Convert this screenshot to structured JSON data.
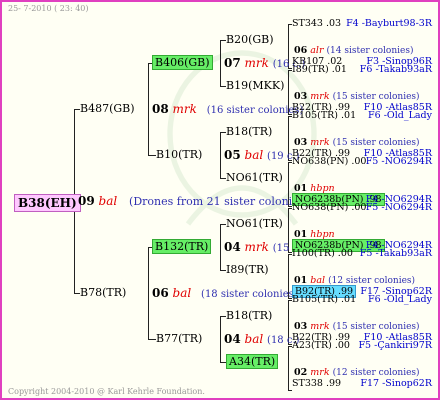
{
  "stamp": "25-  7-2010 ( 23: 40)",
  "copyright": "Copyright 2004-2010 @ Karl Kehrle Foundation.",
  "root": {
    "label": "B38(EH)",
    "year": "09",
    "breed": "bal",
    "note": "(Drones from 21 sister colonies)"
  },
  "g1": [
    {
      "label": "B487(GB)",
      "year": "08",
      "breed": "mrk",
      "note": "(16 sister colonies)"
    },
    {
      "label": "B78(TR)",
      "year": "06",
      "breed": "bal",
      "note": "(18 sister colonies)"
    }
  ],
  "g2": [
    {
      "label": "B406(GB)",
      "year": "07",
      "breed": "mrk",
      "note": "(16 c.)"
    },
    {
      "label": "B10(TR)",
      "year": "05",
      "breed": "bal",
      "note": "(19 c.)"
    },
    {
      "label": "B132(TR)",
      "year": "04",
      "breed": "mrk",
      "note": "(15 c.)"
    },
    {
      "label": "B77(TR)",
      "year": "04",
      "breed": "bal",
      "note": "(18 c.)"
    }
  ],
  "g3": [
    {
      "label": "B20(GB)",
      "year": "06",
      "breed": "alr",
      "note": "(14 sister colonies)"
    },
    {
      "label": "B19(MKK)",
      "year": "03",
      "breed": "mrk",
      "note": "(15 sister colonies)"
    },
    {
      "label": "B18(TR)",
      "year": "03",
      "breed": "mrk",
      "note": "(15 sister colonies)"
    },
    {
      "label": "NO61(TR)",
      "year": "01",
      "breed": "hbpn",
      "note": ""
    },
    {
      "label": "NO61(TR)",
      "year": "01",
      "breed": "hbpn",
      "note": ""
    },
    {
      "label": "I89(TR)",
      "year": "01",
      "breed": "bal",
      "note": "(12 sister colonies)"
    },
    {
      "label": "B18(TR)",
      "year": "03",
      "breed": "mrk",
      "note": "(15 sister colonies)"
    },
    {
      "label": "A34(TR)",
      "year": "02",
      "breed": "mrk",
      "note": "(12 sister colonies)"
    }
  ],
  "g4": [
    {
      "label": "ST343 .03",
      "ref": "F4 -Bayburt98-3R"
    },
    {
      "label": "KB107 .02",
      "ref": "F3 -Sinop96R"
    },
    {
      "label": "I89(TR) .01",
      "ref": "F6 -Takab93aR"
    },
    {
      "label": "B22(TR) .99",
      "ref": "F10 -Atlas85R"
    },
    {
      "label": "B105(TR) .01",
      "ref": "F6 -Old_Lady"
    },
    {
      "label": "B22(TR) .99",
      "ref": "F10 -Atlas85R"
    },
    {
      "label": "NO638(PN) .00",
      "ref": "F5 -NO6294R"
    },
    {
      "label": "NO6238b(PN) .98",
      "ref": "F4 -NO6294R"
    },
    {
      "label": "NO638(PN) .00",
      "ref": "F5 -NO6294R"
    },
    {
      "label": "NO6238b(PN) .98",
      "ref": "F4 -NO6294R"
    },
    {
      "label": "I100(TR) .00",
      "ref": "F5 -Takab93aR"
    },
    {
      "label": "B92(TR) .99",
      "ref": "F17 -Sinop62R"
    },
    {
      "label": "B105(TR) .01",
      "ref": "F6 -Old_Lady"
    },
    {
      "label": "B22(TR) .99",
      "ref": "F10 -Atlas85R"
    },
    {
      "label": "A23(TR) .00",
      "ref": "F5 -Çankiri97R"
    },
    {
      "label": "ST338 .99",
      "ref": "F17 -Sinop62R"
    }
  ]
}
